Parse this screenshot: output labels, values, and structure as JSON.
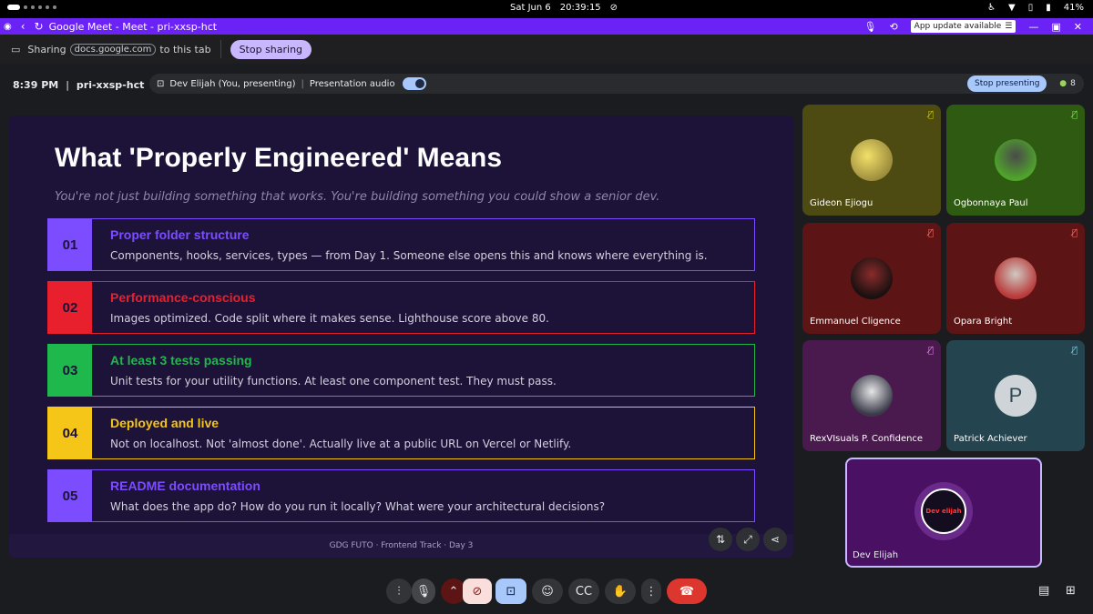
{
  "status_bar": {
    "date": "Sat Jun 6",
    "time": "20:39:15",
    "battery": "41%"
  },
  "browser": {
    "title": "Google Meet - Meet - pri-xxsp-hct",
    "update_label": "App update available"
  },
  "share_bar": {
    "sharing_label": "Sharing",
    "domain": "docs.google.com",
    "suffix": "to this tab",
    "stop_label": "Stop sharing"
  },
  "meeting": {
    "time": "8:39 PM",
    "code": "pri-xxsp-hct",
    "presenter": "Dev Elijah (You, presenting)",
    "audio_label": "Presentation audio",
    "stop_presenting_label": "Stop presenting",
    "people_count": "8"
  },
  "slide": {
    "title": "What 'Properly Engineered' Means",
    "subtitle": "You're not just building something that works. You're building something you could show a senior dev.",
    "items": [
      {
        "num": "01",
        "title": "Proper folder structure",
        "desc": "Components, hooks, services, types — from Day 1. Someone else opens this and knows where everything is.",
        "color": "#7c4dff"
      },
      {
        "num": "02",
        "title": "Performance-conscious",
        "desc": "Images optimized. Code split where it makes sense. Lighthouse score above 80.",
        "color": "#e8202e"
      },
      {
        "num": "03",
        "title": "At least 3 tests passing",
        "desc": "Unit tests for your utility functions. At least one component test. They must pass.",
        "color": "#1fb84c"
      },
      {
        "num": "04",
        "title": "Deployed and live",
        "desc": "Not on localhost. Not 'almost done'. Actually live at a public URL on Vercel or Netlify.",
        "color": "#f5c518"
      },
      {
        "num": "05",
        "title": "README documentation",
        "desc": "What does the app do? How do you run it locally? What were your architectural decisions?",
        "color": "#7c4dff"
      }
    ],
    "footer": "GDG FUTO  ·  Frontend Track  ·  Day 3"
  },
  "participants": [
    {
      "name": "Gideon Ejiogu",
      "bg": "#4d4a12",
      "muted": true
    },
    {
      "name": "Ogbonnaya Paul",
      "bg": "#2f5a12",
      "muted": true
    },
    {
      "name": "Emmanuel Cligence",
      "bg": "#5c1414",
      "muted": true
    },
    {
      "name": "Opara Bright",
      "bg": "#5c1414",
      "muted": true
    },
    {
      "name": "RexVIsuals P. Confidence",
      "bg": "#4a1a4f",
      "muted": true
    },
    {
      "name": "Patrick Achiever",
      "bg": "#24454f",
      "muted": true,
      "initial": "P"
    }
  ],
  "self": {
    "name": "Dev Elijah",
    "logo_text": "Dev elijah"
  }
}
